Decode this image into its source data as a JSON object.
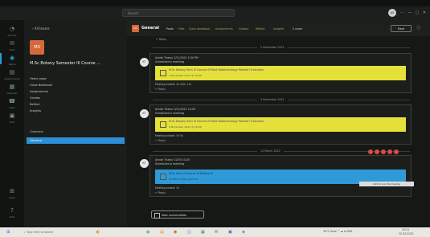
{
  "topbar": {
    "search_placeholder": "Search",
    "avatar_initials": "AS",
    "win_more": "···",
    "win_min": "—",
    "win_max": "▢",
    "win_close": "✕"
  },
  "rail": [
    {
      "icon": "◔",
      "label": "Activity"
    },
    {
      "icon": "✉",
      "label": "Chat"
    },
    {
      "icon": "◉",
      "label": "Teams"
    },
    {
      "icon": "▤",
      "label": "Assignments"
    },
    {
      "icon": "▦",
      "label": "Calendar"
    },
    {
      "icon": "☎",
      "label": "Calls"
    },
    {
      "icon": "▣",
      "label": "Files"
    },
    {
      "icon": "⊞",
      "label": "Apps"
    },
    {
      "icon": "?",
      "label": "Help"
    }
  ],
  "sidebar": {
    "back_label": "All teams",
    "team_initials": "MS",
    "team_name": "M.Sc Botany Semester III Course ...",
    "nav": [
      "Home page",
      "Class Notebook",
      "Assignments",
      "Grades",
      "Reflect",
      "Insights"
    ],
    "channels_header": "Channels",
    "channel_general": "General"
  },
  "channel": {
    "initials": "MS",
    "title": "General",
    "tabs": [
      "Posts",
      "Files",
      "Class Notebook",
      "Assignments",
      "Grades",
      "Reflect",
      "Insights",
      "2 more"
    ],
    "meet_label": "Meet",
    "info_icon": "ⓘ"
  },
  "feed": {
    "top_reply": "↩ Reply",
    "dates": [
      "2 November 2021",
      "9 November 2021",
      "12 March 2022"
    ],
    "posts": [
      {
        "avatar": "KT",
        "meta": "Ashish Thakur   2/11/2021 5:30 PM",
        "scheduled": "Scheduled a meeting",
        "card_title": "M.Sc Botany Sem III Course III Plant Biotechnology Module I Evolution",
        "card_date": "2 November 2021 @ 10:00",
        "ended": "Meeting ended: 1h 20m 11s",
        "reply": "↩ Reply"
      },
      {
        "avatar": "KT",
        "meta": "Ashish Thakur   9/11/2021 10:00",
        "scheduled": "Scheduled a meeting",
        "card_title": "M.Sc Botany Sem III Course III Plant Biotechnology Module I Evolution",
        "card_date": "9 November 2021 @ 10:00",
        "ended": "Meeting ended: 1h 5s",
        "reply": "↩ Reply"
      },
      {
        "avatar": "KT",
        "meta": "Ashish Thakur   12/03 10:20",
        "scheduled": "Scheduled a meeting",
        "card_title": "M.Sc Sem III Course III Module III",
        "card_date": "12 March 2022 @ 10:20",
        "ended": "Meeting ended: 1h",
        "reply": "↩ Reply"
      }
    ],
    "tooltip": "Click to join the meeting",
    "new_conversation": "New conversation"
  },
  "taskbar": {
    "start_icon": "⊞",
    "search_text": "Type here to search",
    "apps": [
      "◐",
      "⌕",
      "▭",
      "◍",
      "▤",
      "◉",
      "◫",
      "▦",
      "✉",
      "▣",
      "◈"
    ],
    "tray": "30°C Haze  ^  ☁  ⊡  ENG",
    "time": "10:21",
    "date": "12-03-2022"
  },
  "colors": {
    "accent": "#2d8fd4",
    "meeting_card_past": "#e5e03a",
    "meeting_card_current": "#2f9ad6",
    "team_tile": "#d46a3a"
  }
}
